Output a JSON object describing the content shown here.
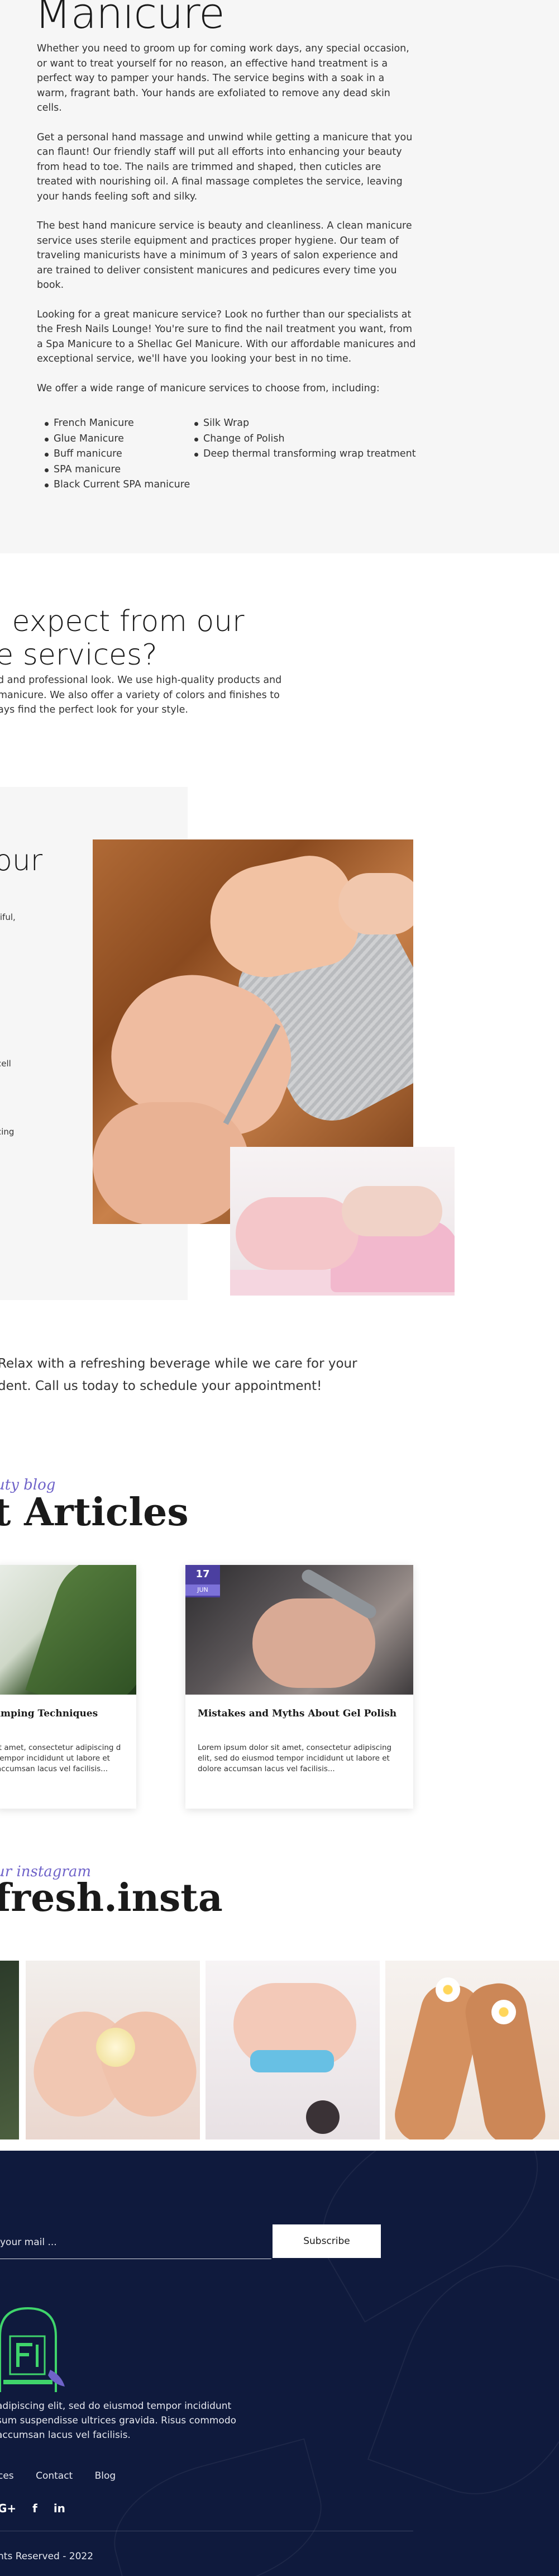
{
  "intro": {
    "title": "Manicure",
    "paragraphs": [
      "Whether you need to groom up for coming work days, any special occasion, or want to treat yourself for no reason, an effective hand treatment is a perfect way to pamper your hands. The service begins with a soak in a warm, fragrant bath. Your hands are exfoliated to remove any dead skin cells.",
      "Get a personal hand massage and unwind while getting a manicure that you can flaunt! Our friendly staff will put all efforts into enhancing your beauty from head to toe. The nails are trimmed and shaped, then cuticles are treated with nourishing oil. A final massage completes the service, leaving your hands feeling soft and silky.",
      "The best hand manicure service is beauty and cleanliness. A clean manicure service uses sterile equipment and practices proper hygiene. Our team of traveling manicurists have a minimum of 3 years of salon experience and are trained to deliver consistent manicures and pedicures every time you book.",
      "Looking for a great manicure service? Look no further than our specialists at the Fresh Nails Lounge! You're sure to find the nail treatment you want, from a Spa Manicure to a Shellac Gel Manicure. With our affordable manicures and exceptional service, we'll have you looking your best in no time.",
      "We offer a wide range of manicure services to choose from, including:"
    ],
    "services_col1": [
      "French Manicure",
      "Glue Manicure",
      "Buff manicure",
      "SPA manicure",
      "Black Current SPA manicure"
    ],
    "services_col2": [
      "Silk Wrap",
      "Change of Polish",
      "Deep thermal transforming wrap treatment"
    ]
  },
  "expect": {
    "title_line1": "n expect from our",
    "title_line2": "re services?",
    "body": "d and professional look. We use high-quality products and manicure. We also offer a variety of colors and finishes to ays find the perfect look for your style."
  },
  "image_block": {
    "side_title": "our",
    "frag1": "tiful,",
    "frag2": "cell",
    "frag3": "cing"
  },
  "relax": {
    "text": "Relax with a refreshing beverage while we care for your dent. Call us today to schedule your appointment!"
  },
  "blog": {
    "script": "uty blog",
    "title": "t Articles",
    "cards": [
      {
        "title": "amping Techniques",
        "text": "it amet, consectetur adipiscing d tempor incididunt ut labore et accumsan lacus vel facilisis..."
      },
      {
        "day": "17",
        "month": "JUN",
        "title": "Mistakes and Myths About Gel Polish",
        "text": "Lorem ipsum dolor sit amet, consectetur adipiscing elit, sed do eiusmod tempor incididunt ut labore et dolore accumsan lacus vel facilisis..."
      }
    ]
  },
  "instagram": {
    "script": "ur instagram",
    "title": "fresh.insta"
  },
  "footer": {
    "email_placeholder": "your mail ...",
    "subscribe_label": "Subscribe",
    "about": "adipiscing elit, sed do eiusmod tempor incididunt sum suspendisse ultrices gravida. Risus commodo accumsan lacus vel facilisis.",
    "links": [
      "ces",
      "Contact",
      "Blog"
    ],
    "social": [
      "G+",
      "f",
      "in"
    ],
    "copyright": "nts Reserved - 2022"
  },
  "colors": {
    "accent_purple": "#6f63c9",
    "badge_purple": "#4b3fa0",
    "footer_navy": "#0f1a3d",
    "section_gray": "#f6f6f6",
    "logo_green": "#3fd46b"
  }
}
